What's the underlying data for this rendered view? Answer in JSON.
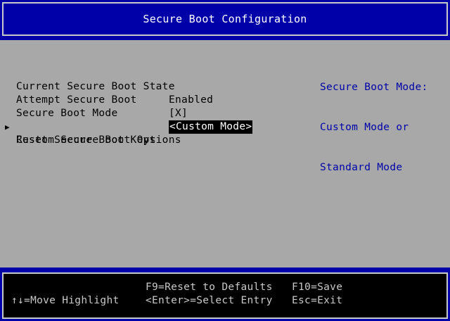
{
  "title": "Secure Boot Configuration",
  "colors": {
    "header_bg": "#0000a8",
    "main_bg": "#a8a8a8",
    "help_text": "#0000a8",
    "footer_bg": "#000000",
    "footer_text": "#c8c8c8"
  },
  "menu": [
    {
      "label": "Current Secure Boot State",
      "value": "Enabled",
      "submenu": false,
      "selected": false
    },
    {
      "label": "Attempt Secure Boot",
      "value": "[X]",
      "submenu": false,
      "selected": false
    },
    {
      "label": "Secure Boot Mode",
      "value": "<Custom Mode>",
      "submenu": false,
      "selected": true
    },
    {
      "label": "Custom Secure Boot Options",
      "value": "",
      "submenu": true,
      "selected": false
    },
    {
      "label": "Reset Secure Boot Keys",
      "value": "",
      "submenu": false,
      "selected": false
    }
  ],
  "submenu_icon": "triangle-right-icon",
  "help": {
    "line1": "Secure Boot Mode:",
    "line2": "Custom Mode or",
    "line3": "Standard Mode"
  },
  "footer": {
    "reset_defaults": "F9=Reset to Defaults",
    "save": "F10=Save",
    "move_highlight": "↑↓=Move Highlight",
    "select_entry": "<Enter>=Select Entry",
    "exit": "Esc=Exit"
  }
}
